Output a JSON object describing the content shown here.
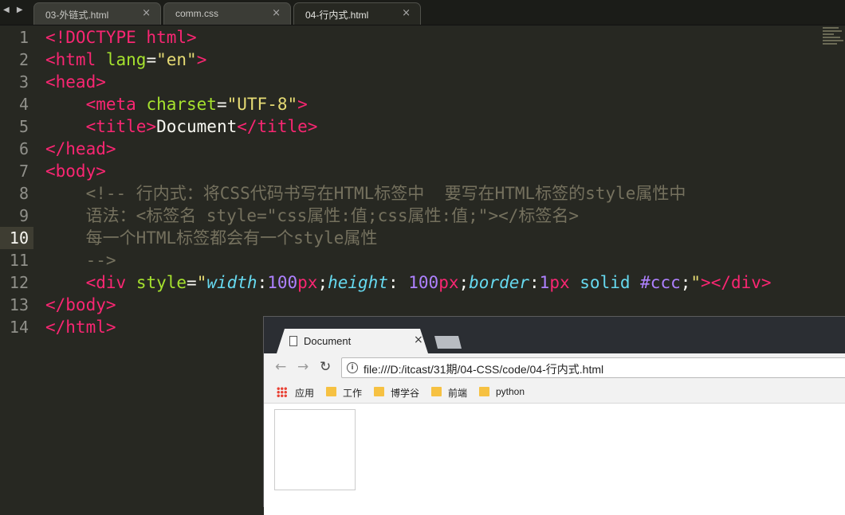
{
  "editor": {
    "tabs": [
      {
        "label": "03-外链式.html",
        "close": "×"
      },
      {
        "label": "comm.css",
        "close": "×"
      },
      {
        "label": "04-行内式.html",
        "close": "×"
      }
    ],
    "nav_arrows": "◀ ▶",
    "lines": [
      {
        "num": "1",
        "segs": [
          [
            "t",
            "<!DOCTYPE html>"
          ]
        ]
      },
      {
        "num": "2",
        "segs": [
          [
            "t",
            "<html"
          ],
          [
            "x",
            " "
          ],
          [
            "a",
            "lang"
          ],
          [
            "x",
            "="
          ],
          [
            "s",
            "\"en\""
          ],
          [
            "t",
            ">"
          ]
        ]
      },
      {
        "num": "3",
        "segs": [
          [
            "t",
            "<head>"
          ]
        ]
      },
      {
        "num": "4",
        "segs": [
          [
            "x",
            "    "
          ],
          [
            "t",
            "<meta"
          ],
          [
            "x",
            " "
          ],
          [
            "a",
            "charset"
          ],
          [
            "x",
            "="
          ],
          [
            "s",
            "\"UTF-8\""
          ],
          [
            "t",
            ">"
          ]
        ]
      },
      {
        "num": "5",
        "segs": [
          [
            "x",
            "    "
          ],
          [
            "t",
            "<title>"
          ],
          [
            "x",
            "Document"
          ],
          [
            "t",
            "</title>"
          ]
        ]
      },
      {
        "num": "6",
        "segs": [
          [
            "t",
            "</head>"
          ]
        ]
      },
      {
        "num": "7",
        "segs": [
          [
            "t",
            "<body>"
          ]
        ]
      },
      {
        "num": "8",
        "segs": [
          [
            "x",
            "    "
          ],
          [
            "c",
            "<!-- 行内式：将CSS代码书写在HTML标签中  要写在HTML标签的style属性中"
          ]
        ]
      },
      {
        "num": "9",
        "segs": [
          [
            "x",
            "    "
          ],
          [
            "c",
            "语法：<标签名 style=\"css属性:值;css属性:值;\"></标签名>"
          ]
        ]
      },
      {
        "num": "10",
        "segs": [
          [
            "x",
            "    "
          ],
          [
            "c",
            "每一个HTML标签都会有一个style属性"
          ]
        ]
      },
      {
        "num": "11",
        "segs": [
          [
            "x",
            "    "
          ],
          [
            "c",
            "-->"
          ]
        ]
      },
      {
        "num": "12",
        "segs": [
          [
            "x",
            "    "
          ],
          [
            "t",
            "<div"
          ],
          [
            "x",
            " "
          ],
          [
            "a",
            "style"
          ],
          [
            "x",
            "="
          ],
          [
            "s",
            "\""
          ],
          [
            "p",
            "width"
          ],
          [
            "x",
            ":"
          ],
          [
            "n",
            "100"
          ],
          [
            "t",
            "px"
          ],
          [
            "x",
            ";"
          ],
          [
            "p",
            "height"
          ],
          [
            "x",
            ": "
          ],
          [
            "n",
            "100"
          ],
          [
            "t",
            "px"
          ],
          [
            "x",
            ";"
          ],
          [
            "p",
            "border"
          ],
          [
            "x",
            ":"
          ],
          [
            "n",
            "1"
          ],
          [
            "t",
            "px"
          ],
          [
            "x",
            " "
          ],
          [
            "k",
            "solid"
          ],
          [
            "x",
            " "
          ],
          [
            "n",
            "#ccc"
          ],
          [
            "x",
            ";"
          ],
          [
            "s",
            "\""
          ],
          [
            "t",
            ">"
          ],
          [
            "t",
            "</div>"
          ]
        ]
      },
      {
        "num": "13",
        "segs": [
          [
            "t",
            "</body>"
          ]
        ]
      },
      {
        "num": "14",
        "segs": [
          [
            "t",
            "</html>"
          ]
        ]
      }
    ],
    "current_line": "10"
  },
  "browser": {
    "tab_title": "Document",
    "tab_close": "×",
    "back": "←",
    "forward": "→",
    "reload": "↻",
    "info": "i",
    "url": "file:///D:/itcast/31期/04-CSS/code/04-行内式.html",
    "bookmarks": [
      "应用",
      "工作",
      "博学谷",
      "前端",
      "python"
    ]
  },
  "colors": {
    "tag": "#f92672",
    "attribute": "#a6e22e",
    "string": "#e6db74",
    "comment": "#75715e",
    "property": "#66d9ef",
    "number": "#ae81ff",
    "background": "#272822"
  }
}
